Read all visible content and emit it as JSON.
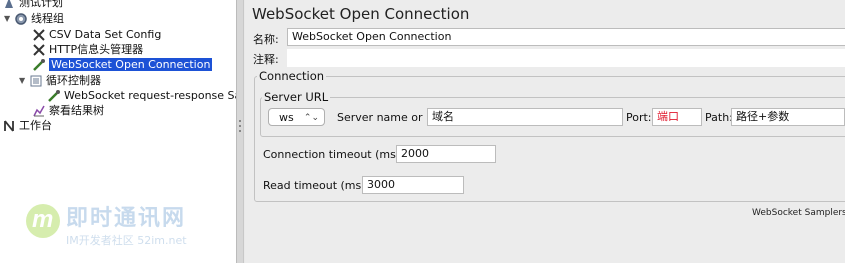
{
  "tree": {
    "items": [
      {
        "label": "测试计划",
        "icon": "test-plan-icon"
      },
      {
        "label": "线程组",
        "icon": "thread-group-gear-icon"
      },
      {
        "label": "CSV Data Set Config",
        "icon": "config-scissors-icon"
      },
      {
        "label": "HTTP信息头管理器",
        "icon": "config-scissors-icon"
      },
      {
        "label": "WebSocket Open Connection",
        "icon": "sampler-pipette-icon"
      },
      {
        "label": "循环控制器",
        "icon": "loop-controller-icon"
      },
      {
        "label": "WebSocket request-response Sampl",
        "icon": "sampler-pipette-icon"
      },
      {
        "label": "察看结果树",
        "icon": "listener-chart-icon"
      },
      {
        "label": "工作台",
        "icon": "workbench-icon"
      }
    ],
    "selected_index": 4
  },
  "watermark": {
    "title": "即时通讯网",
    "subtitle": "IM开发者社区 52im.net"
  },
  "panel": {
    "title": "WebSocket Open Connection",
    "name_label": "名称:",
    "name_value": "WebSocket Open Connection",
    "comment_label": "注释:",
    "comment_value": "",
    "connection_legend": "Connection",
    "server_url_legend": "Server URL",
    "protocol": "ws",
    "server_label": "Server name or IP:",
    "server_value": "域名",
    "port_label": "Port:",
    "port_value": "端口",
    "path_label": "Path:",
    "path_value": "路径+参数",
    "conn_timeout_label": "Connection timeout (ms):",
    "conn_timeout_value": "2000",
    "read_timeout_label": "Read timeout (ms):",
    "read_timeout_value": "3000",
    "footer_note": "WebSocket Samplers plu"
  },
  "colors": {
    "selection": "#1d52d6",
    "port_text": "#e0182d"
  }
}
